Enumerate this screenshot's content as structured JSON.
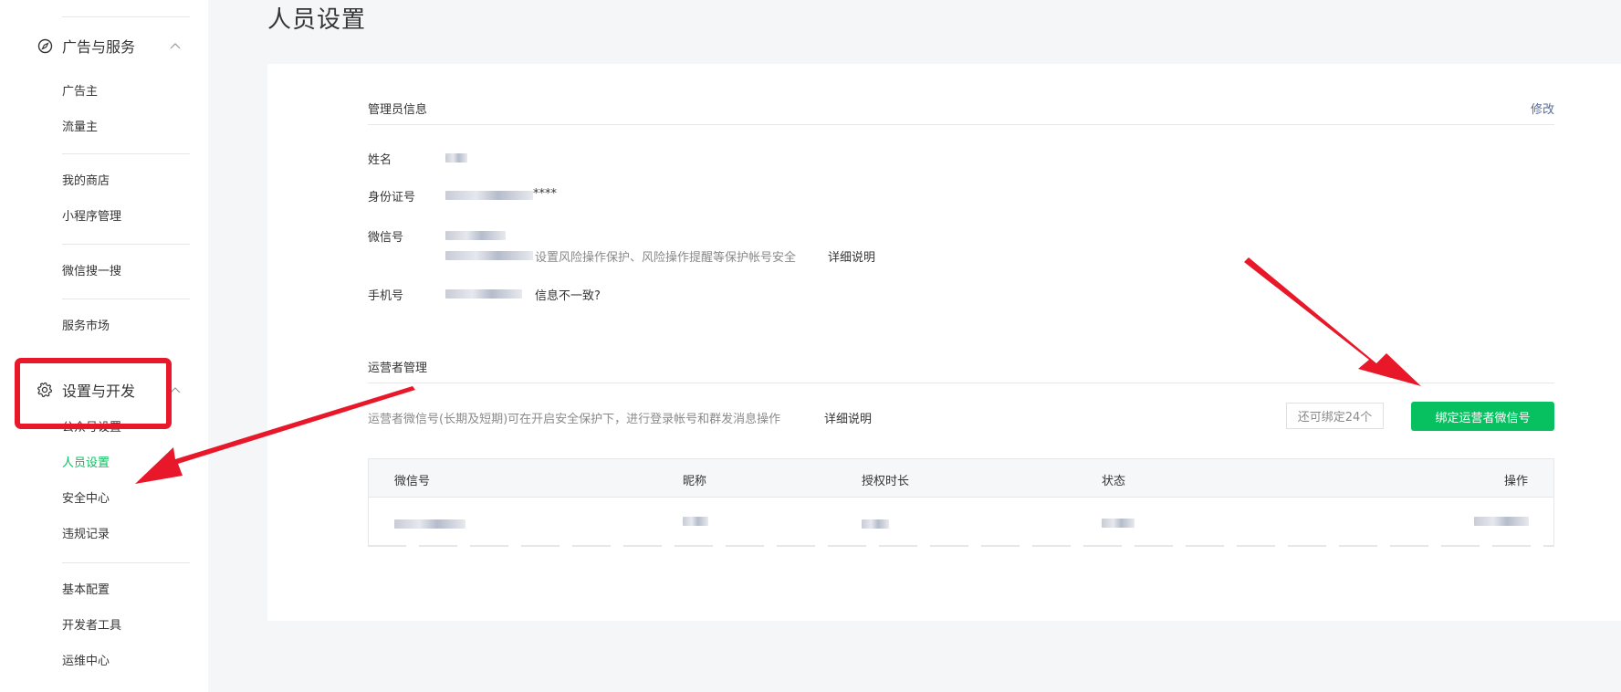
{
  "sidebar": {
    "groups": [
      {
        "label": "广告与服务",
        "icon": "compass-icon",
        "expanded": true
      },
      {
        "label": "设置与开发",
        "icon": "gear-icon",
        "expanded": true
      }
    ],
    "items": [
      "广告主",
      "流量主",
      "我的商店",
      "小程序管理",
      "微信搜一搜",
      "服务市场",
      "公众号设置",
      "人员设置",
      "安全中心",
      "违规记录",
      "基本配置",
      "开发者工具",
      "运维中心"
    ],
    "active_item": "人员设置"
  },
  "page": {
    "title": "人员设置"
  },
  "admin": {
    "section_title": "管理员信息",
    "edit_label": "修改",
    "fields": {
      "name_label": "姓名",
      "id_label": "身份证号",
      "id_suffix": "****",
      "wechat_label": "微信号",
      "wechat_note": "设置风险操作保护、风险操作提醒等保护帐号安全",
      "wechat_link": "详细说明",
      "phone_label": "手机号",
      "phone_link": "信息不一致?"
    }
  },
  "operators": {
    "section_title": "运营者管理",
    "desc": "运营者微信号(长期及短期)可在开启安全保护下，进行登录帐号和群发消息操作",
    "desc_link": "详细说明",
    "quota_label": "还可绑定24个",
    "bind_button": "绑定运营者微信号",
    "table": {
      "columns": [
        "微信号",
        "昵称",
        "授权时长",
        "状态",
        "操作"
      ]
    }
  },
  "colors": {
    "accent_green": "#07c160",
    "link_blue": "#576b95",
    "annotation_red": "#e8182a"
  }
}
